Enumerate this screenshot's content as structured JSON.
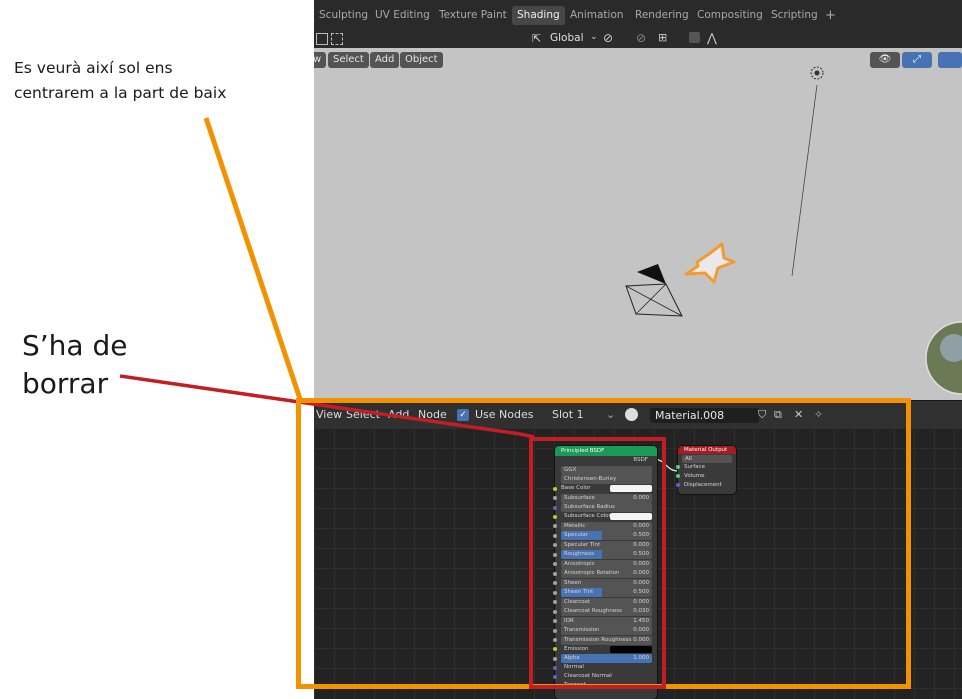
{
  "annotations": {
    "note_top_line1": "Es veurà així sol ens",
    "note_top_line2": "centrarem a la part de baix",
    "note_delete_line1": "S’ha de",
    "note_delete_line2": "borrar"
  },
  "colors": {
    "orange": "#f39200",
    "red": "#c41e25",
    "blender_accent": "#4772b3"
  },
  "topbar": {
    "tabs": [
      "Sculpting",
      "UV Editing",
      "Texture Paint",
      "Shading",
      "Animation",
      "Rendering",
      "Compositing",
      "Scripting",
      "+"
    ],
    "active_tab": "Shading"
  },
  "viewport_header": {
    "orientation": "Global"
  },
  "viewport_menu": {
    "view": "w",
    "select": "Select",
    "add": "Add",
    "object": "Object"
  },
  "node_editor_header": {
    "view": "View",
    "select": "Select",
    "add": "Add",
    "node": "Node",
    "use_nodes": "Use Nodes",
    "slot": "Slot 1",
    "material": "Material.008"
  },
  "bsdf_node": {
    "title": "Principled BSDF",
    "output": "BSDF",
    "distribution": "GGX",
    "subsurface_method": "Christensen-Burley",
    "base_color": "Base Color",
    "inputs": [
      {
        "label": "Subsurface",
        "value": "0.000",
        "kind": "field"
      },
      {
        "label": "Subsurface Radius",
        "value": "",
        "kind": "dropdown"
      },
      {
        "label": "Subsurface Color",
        "value": "",
        "kind": "color"
      },
      {
        "label": "Metallic",
        "value": "0.000",
        "kind": "field"
      },
      {
        "label": "Specular",
        "value": "0.500",
        "kind": "blue"
      },
      {
        "label": "Specular Tint",
        "value": "0.000",
        "kind": "field"
      },
      {
        "label": "Roughness",
        "value": "0.500",
        "kind": "blue"
      },
      {
        "label": "Anisotropic",
        "value": "0.000",
        "kind": "field"
      },
      {
        "label": "Anisotropic Rotation",
        "value": "0.000",
        "kind": "field"
      },
      {
        "label": "Sheen",
        "value": "0.000",
        "kind": "field"
      },
      {
        "label": "Sheen Tint",
        "value": "0.500",
        "kind": "blue"
      },
      {
        "label": "Clearcoat",
        "value": "0.000",
        "kind": "field"
      },
      {
        "label": "Clearcoat Roughness",
        "value": "0.030",
        "kind": "field"
      },
      {
        "label": "IOR",
        "value": "1.450",
        "kind": "field"
      },
      {
        "label": "Transmission",
        "value": "0.000",
        "kind": "field"
      },
      {
        "label": "Transmission Roughness",
        "value": "0.000",
        "kind": "field"
      },
      {
        "label": "Emission",
        "value": "",
        "kind": "black"
      },
      {
        "label": "Alpha",
        "value": "1.000",
        "kind": "fullblue"
      },
      {
        "label": "Normal",
        "value": "",
        "kind": "plain"
      },
      {
        "label": "Clearcoat Normal",
        "value": "",
        "kind": "plain"
      },
      {
        "label": "Tangent",
        "value": "",
        "kind": "plain"
      }
    ]
  },
  "output_node": {
    "title": "Material Output",
    "target": "All",
    "surface": "Surface",
    "volume": "Volume",
    "displacement": "Displacement"
  }
}
